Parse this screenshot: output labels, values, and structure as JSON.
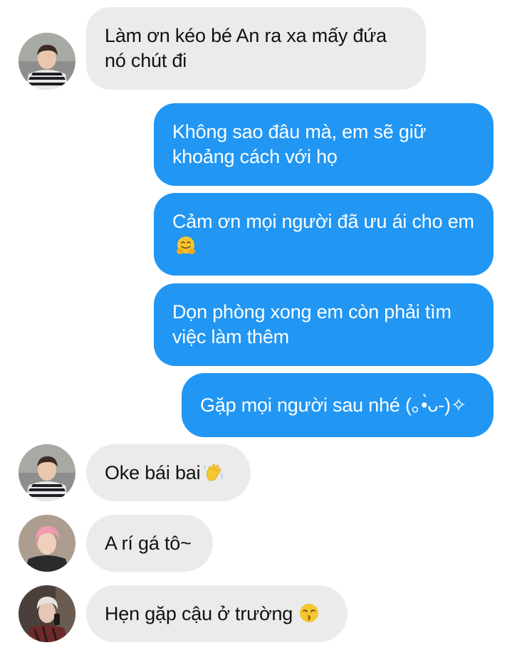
{
  "messages": [
    {
      "id": "m1",
      "side": "incoming",
      "sender": "user-1",
      "text": "Làm ơn kéo bé An ra xa mấy đứa nó chút đi",
      "emoji": ""
    },
    {
      "id": "m2",
      "side": "outgoing",
      "text": "Không sao đâu mà, em sẽ giữ khoảng cách với họ",
      "emoji": ""
    },
    {
      "id": "m3",
      "side": "outgoing",
      "text": "Cảm ơn mọi người đã ưu ái cho em",
      "emoji": "hugging-face-emoji"
    },
    {
      "id": "m4",
      "side": "outgoing",
      "text": "Dọn phòng xong em còn phải tìm việc làm thêm",
      "emoji": ""
    },
    {
      "id": "m5",
      "side": "outgoing",
      "text": "Gặp mọi người sau nhé (｡•̀ᴗ-)✧",
      "emoji": ""
    },
    {
      "id": "m6",
      "side": "incoming",
      "sender": "user-1",
      "text": "Oke bái bai",
      "emoji": "waving-hand-emoji"
    },
    {
      "id": "m7",
      "side": "incoming",
      "sender": "user-2",
      "text": "A rí gá tô~",
      "emoji": ""
    },
    {
      "id": "m8",
      "side": "incoming",
      "sender": "user-3",
      "text": "Hẹn gặp cậu ở trường",
      "emoji": "kissing-face-emoji"
    }
  ],
  "colors": {
    "outgoing_bubble": "#2196f3",
    "incoming_bubble": "#ebebeb",
    "outgoing_text": "#ffffff",
    "incoming_text": "#121212"
  }
}
